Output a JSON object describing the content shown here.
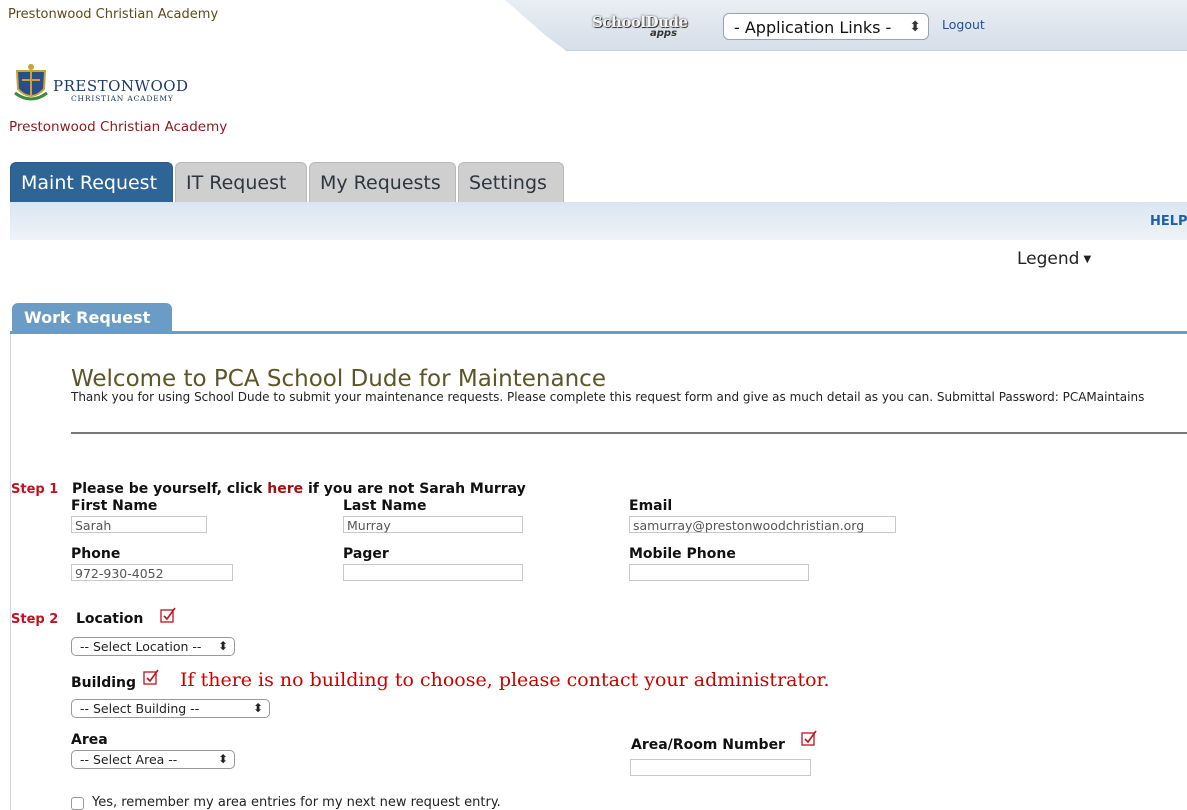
{
  "header": {
    "org_top": "Prestonwood Christian Academy",
    "schooldude_logo": "SchoolDude",
    "schooldude_apps": "apps",
    "app_links_value": "- Application Links -",
    "logout": "Logout"
  },
  "logo": {
    "line1": "PRESTONWOOD",
    "line2": "CHRISTIAN ACADEMY",
    "crest_icon": "school-crest-icon"
  },
  "org_name": "Prestonwood Christian Academy",
  "tabs": [
    {
      "label": "Maint Request",
      "active": true
    },
    {
      "label": "IT Request"
    },
    {
      "label": "My Requests"
    },
    {
      "label": "Settings"
    }
  ],
  "help": "HELP",
  "legend": "Legend",
  "work_request_tab": "Work Request",
  "welcome": {
    "title": "Welcome to PCA School Dude for Maintenance",
    "body": "Thank you for using School Dude to submit your maintenance requests. Please complete this request form and give as much detail as you can. Submittal Password: PCAMaintains"
  },
  "step1": {
    "step_label": "Step 1",
    "text_before": "Please be yourself, click ",
    "link": "here",
    "text_after": " if you are not Sarah Murray",
    "first_name_label": "First Name",
    "first_name_value": "Sarah",
    "last_name_label": "Last Name",
    "last_name_value": "Murray",
    "email_label": "Email",
    "email_value": "samurray@prestonwoodchristian.org",
    "phone_label": "Phone",
    "phone_value": "972-930-4052",
    "pager_label": "Pager",
    "pager_value": "",
    "mobile_label": "Mobile Phone",
    "mobile_value": ""
  },
  "step2": {
    "step_label": "Step 2",
    "location_label": "Location",
    "location_select": "-- Select Location --",
    "building_label": "Building",
    "building_message": "If there is no building to choose, please contact your administrator.",
    "building_select": "-- Select Building --",
    "area_label": "Area",
    "area_select": "-- Select Area --",
    "room_label": "Area/Room Number",
    "room_value": "",
    "remember_text": "Yes, remember my area entries for my next new request entry."
  },
  "colors": {
    "active_tab": "#2e6496",
    "required_red": "#c1121f",
    "work_request_tab": "#6a9cc6"
  }
}
